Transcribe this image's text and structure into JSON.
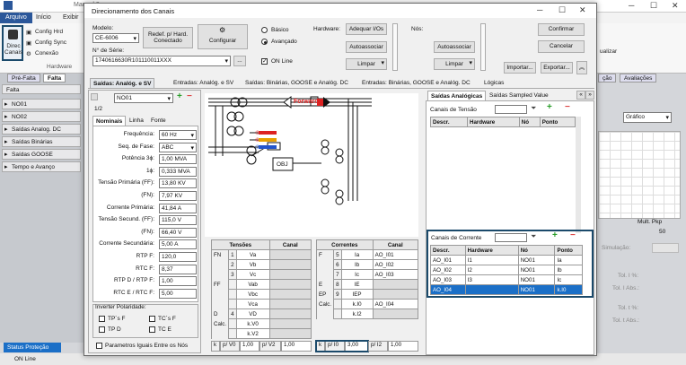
{
  "app": {
    "title_partial": "Manual 2",
    "ribbon_tabs": [
      "Arquivo",
      "Início",
      "Exibir"
    ],
    "ribbon_items": {
      "direc": "Direc Canais",
      "config_hrd": "Config Hrd",
      "config_sync": "Config Sync",
      "conexao": "Conexão",
      "group": "Hardware",
      "atualizar": "ualizar"
    },
    "panel_tabs": [
      "Pré-Falta",
      "Falta"
    ],
    "falta_header": "Falta",
    "left_items": [
      "NO01",
      "NO02",
      "Saídas Analog. DC",
      "Saídas Binárias",
      "Saídas GOOSE",
      "Tempo e Avanço"
    ],
    "right_tabs": [
      "ção",
      "Avaliações"
    ],
    "right_dropdown": "Gráfico",
    "right_labels": {
      "mult": "Mult. Pkp",
      "val": "50",
      "simulacao": "Simulação:",
      "tol1": "Tol. I %:",
      "tol1abs": "Tol. I Abs.:",
      "tol2": "Tol. t %:",
      "tol2abs": "Tol. t Abs.:"
    },
    "status_tab": "Status Proteção",
    "status_online": "ON Line"
  },
  "dialog": {
    "title": "Direcionamento dos Canais",
    "modelo_label": "Modelo:",
    "modelo_value": "CE-6006",
    "serie_label": "N° de Série:",
    "serie_value": "1740616630R101110011XXX",
    "btn_redef": "Redef. p/ Hard. Conectado",
    "btn_configurar": "Configurar",
    "radio_basico": "Básico",
    "radio_avancado": "Avançado",
    "chk_online": "ON Line",
    "hardware_label": "Hardware:",
    "nos_label": "Nós:",
    "btn_adequar": "Adequar I/Os",
    "btn_autoassociar": "Autoassociar",
    "btn_limpar": "Limpar",
    "btn_autoassociar2": "Autoassociar",
    "btn_limpar2": "Limpar",
    "btn_confirmar": "Confirmar",
    "btn_cancelar": "Cancelar",
    "btn_importar": "Importar...",
    "btn_exportar": "Exportar...",
    "main_tabs": [
      "Saídas: Analóg. e SV",
      "Entradas: Analóg. e SV",
      "Saídas: Binárias, GOOSE e Analóg. DC",
      "Entradas: Binárias, GOOSE e Analóg. DC",
      "Lógicas"
    ],
    "node_value": "NO01",
    "page": "1/2",
    "sub_tabs": [
      "Nominais",
      "Linha",
      "Fonte"
    ],
    "nominais": [
      {
        "label": "Frequência:",
        "value": "60 Hz",
        "dd": true
      },
      {
        "label": "Seq. de Fase:",
        "value": "ABC",
        "dd": true
      },
      {
        "label": "Potência 3ϕ:",
        "value": "1,00 MVA",
        "dd": false
      },
      {
        "label": "1ϕ:",
        "value": "0,333 MVA",
        "dd": false
      },
      {
        "label": "Tensão Primária (FF):",
        "value": "13,80 KV",
        "dd": false
      },
      {
        "label": "(FN):",
        "value": "7,97 KV",
        "dd": false
      },
      {
        "label": "Corrente Primária:",
        "value": "41,84 A",
        "dd": false
      },
      {
        "label": "Tensão Secund. (FF):",
        "value": "115,0 V",
        "dd": false
      },
      {
        "label": "(FN):",
        "value": "66,40 V",
        "dd": false
      },
      {
        "label": "Corrente Secundária:",
        "value": "5,00 A",
        "dd": false
      },
      {
        "label": "RTP F:",
        "value": "120,0",
        "dd": false
      },
      {
        "label": "RTC F:",
        "value": "8,37",
        "dd": false
      },
      {
        "label": "RTP D / RTP F:",
        "value": "1,00",
        "dd": false
      },
      {
        "label": "RTC E / RTC F:",
        "value": "5,00",
        "dd": false
      }
    ],
    "inverter_label": "Inverter Polaridade:",
    "inverter": [
      "TP´s F",
      "TC´s F",
      "TP D",
      "TC E"
    ],
    "params_label": "Parametros Iguais Entre os Nós",
    "diagram": {
      "forward": "Forward",
      "obj": "OBJ"
    },
    "tensoes": {
      "h1": "Tensões",
      "h2": "Canal",
      "rows": [
        {
          "g": "FN",
          "n": "1",
          "l": "Va",
          "c": ""
        },
        {
          "g": "",
          "n": "2",
          "l": "Vb",
          "c": ""
        },
        {
          "g": "",
          "n": "3",
          "l": "Vc",
          "c": ""
        },
        {
          "g": "FF",
          "n": "",
          "l": "Vab",
          "c": ""
        },
        {
          "g": "",
          "n": "",
          "l": "Vbc",
          "c": ""
        },
        {
          "g": "",
          "n": "",
          "l": "Vca",
          "c": ""
        },
        {
          "g": "D",
          "n": "4",
          "l": "VD",
          "c": ""
        },
        {
          "g": "Calc.",
          "n": "",
          "l": "k.V0",
          "c": ""
        },
        {
          "g": "",
          "n": "",
          "l": "k.V2",
          "c": ""
        }
      ],
      "foot": {
        "k": "k",
        "p0": "p/ V0",
        "v0": "1,00",
        "p2": "p/ V2",
        "v2": "1,00"
      }
    },
    "correntes": {
      "h1": "Correntes",
      "h2": "Canal",
      "rows": [
        {
          "g": "F",
          "n": "5",
          "l": "Ia",
          "c": "AO_I01"
        },
        {
          "g": "",
          "n": "6",
          "l": "Ib",
          "c": "AO_I02"
        },
        {
          "g": "",
          "n": "7",
          "l": "Ic",
          "c": "AO_I03"
        },
        {
          "g": "E",
          "n": "8",
          "l": "IE",
          "c": ""
        },
        {
          "g": "EP",
          "n": "9",
          "l": "IEP",
          "c": ""
        },
        {
          "g": "Calc.",
          "n": "",
          "l": "k.I0",
          "c": "AO_I04"
        },
        {
          "g": "",
          "n": "",
          "l": "k.I2",
          "c": ""
        }
      ],
      "foot": {
        "k": "k",
        "p0": "p/ I0",
        "v0": "3,00",
        "p2": "p/ I2",
        "v2": "1,00"
      }
    },
    "right_tabs": [
      "Saídas Analógicas",
      "Saídas Sampled Value"
    ],
    "canais_tensao": "Canais de Tensão",
    "canais_corrente": "Canais de Corrente",
    "grid_headers": [
      "Descr.",
      "Hardware",
      "Nó",
      "Ponto"
    ],
    "corrente_rows": [
      {
        "d": "AO_I01",
        "h": "I1",
        "n": "NO01",
        "p": "Ia"
      },
      {
        "d": "AO_I02",
        "h": "I2",
        "n": "NO01",
        "p": "Ib"
      },
      {
        "d": "AO_I03",
        "h": "I3",
        "n": "NO01",
        "p": "Ic"
      },
      {
        "d": "AO_I04",
        "h": "",
        "n": "NO01",
        "p": "k.I0"
      }
    ]
  }
}
